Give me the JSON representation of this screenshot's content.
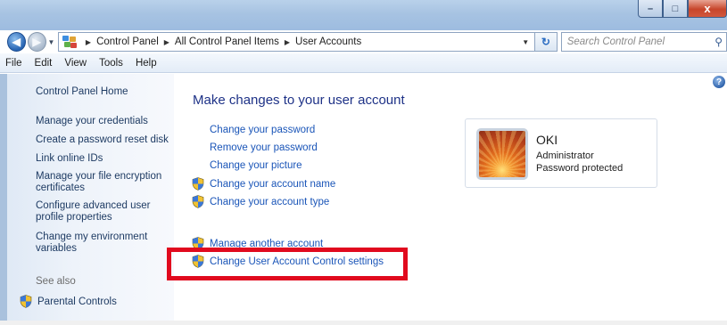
{
  "window": {
    "minimize_label": "–",
    "maximize_label": "□",
    "close_label": "x"
  },
  "address": {
    "crumbs": [
      "Control Panel",
      "All Control Panel Items",
      "User Accounts"
    ],
    "search_placeholder": "Search Control Panel"
  },
  "menu": [
    "File",
    "Edit",
    "View",
    "Tools",
    "Help"
  ],
  "sidebar": {
    "home": "Control Panel Home",
    "links": [
      "Manage your credentials",
      "Create a password reset disk",
      "Link online IDs",
      "Manage your file encryption certificates",
      "Configure advanced user profile properties",
      "Change my environment variables"
    ],
    "see_also": "See also",
    "parental": "Parental Controls"
  },
  "main": {
    "title": "Make changes to your user account",
    "tasks": [
      {
        "label": "Change your password",
        "shield": false
      },
      {
        "label": "Remove your password",
        "shield": false
      },
      {
        "label": "Change your picture",
        "shield": false
      },
      {
        "label": "Change your account name",
        "shield": true
      },
      {
        "label": "Change your account type",
        "shield": true
      }
    ],
    "other_tasks": [
      {
        "label": "Manage another account",
        "shield": true
      },
      {
        "label": "Change User Account Control settings",
        "shield": true
      }
    ]
  },
  "account": {
    "name": "OKI",
    "role": "Administrator",
    "status": "Password protected"
  },
  "colors": {
    "link": "#1a55b8",
    "highlight": "#e10a1e",
    "title": "#1e3287"
  }
}
